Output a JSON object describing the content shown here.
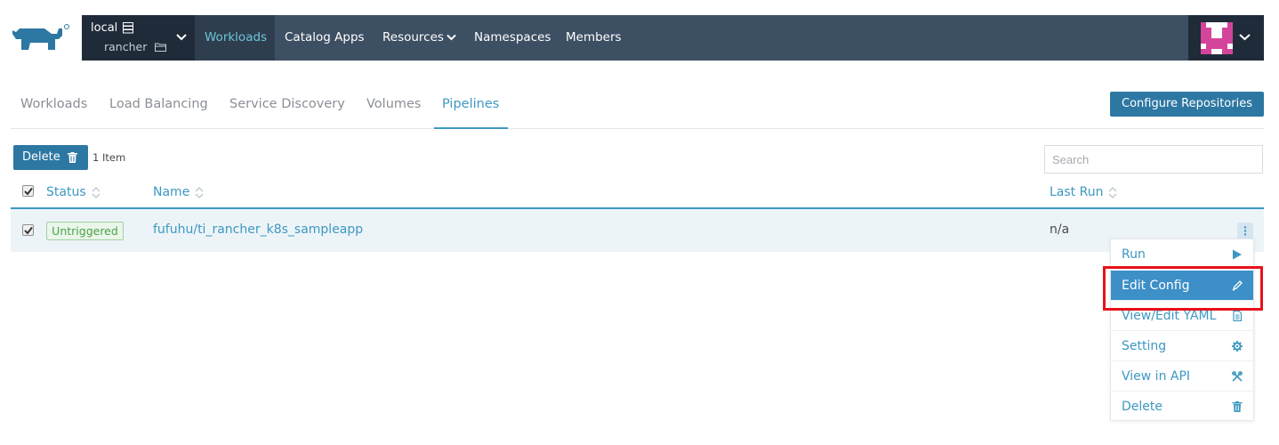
{
  "header": {
    "cluster": {
      "name": "local",
      "project": "rancher"
    },
    "nav": [
      {
        "label": "Workloads",
        "active": true
      },
      {
        "label": "Catalog Apps"
      },
      {
        "label": "Resources",
        "has_dropdown": true
      },
      {
        "label": "Namespaces"
      },
      {
        "label": "Members"
      }
    ]
  },
  "tabs": [
    {
      "label": "Workloads"
    },
    {
      "label": "Load Balancing"
    },
    {
      "label": "Service Discovery"
    },
    {
      "label": "Volumes"
    },
    {
      "label": "Pipelines",
      "active": true
    }
  ],
  "configure_button": "Configure Repositories",
  "toolbar": {
    "delete_label": "Delete",
    "item_count": "1 Item",
    "search_placeholder": "Search"
  },
  "table": {
    "columns": [
      "Status",
      "Name",
      "Last Run"
    ],
    "rows": [
      {
        "status": "Untriggered",
        "name": "fufuhu/ti_rancher_k8s_sampleapp",
        "last_run": "n/a",
        "checked": true
      }
    ]
  },
  "menu": {
    "items": [
      {
        "label": "Run",
        "icon": "play-icon"
      },
      {
        "label": "Edit Config",
        "icon": "pencil-icon",
        "highlighted": true
      },
      {
        "label": "View/Edit YAML",
        "icon": "file-icon"
      },
      {
        "label": "Setting",
        "icon": "gear-icon"
      },
      {
        "label": "View in API",
        "icon": "tools-icon"
      },
      {
        "label": "Delete",
        "icon": "trash-icon"
      }
    ]
  },
  "colors": {
    "topbar": "#3d4f63",
    "topbar_dark": "#1f2b38",
    "accent": "#3d98c1",
    "button": "#2d77a3",
    "highlight_box": "#e8121a",
    "badge_green": "#4ca14c"
  }
}
